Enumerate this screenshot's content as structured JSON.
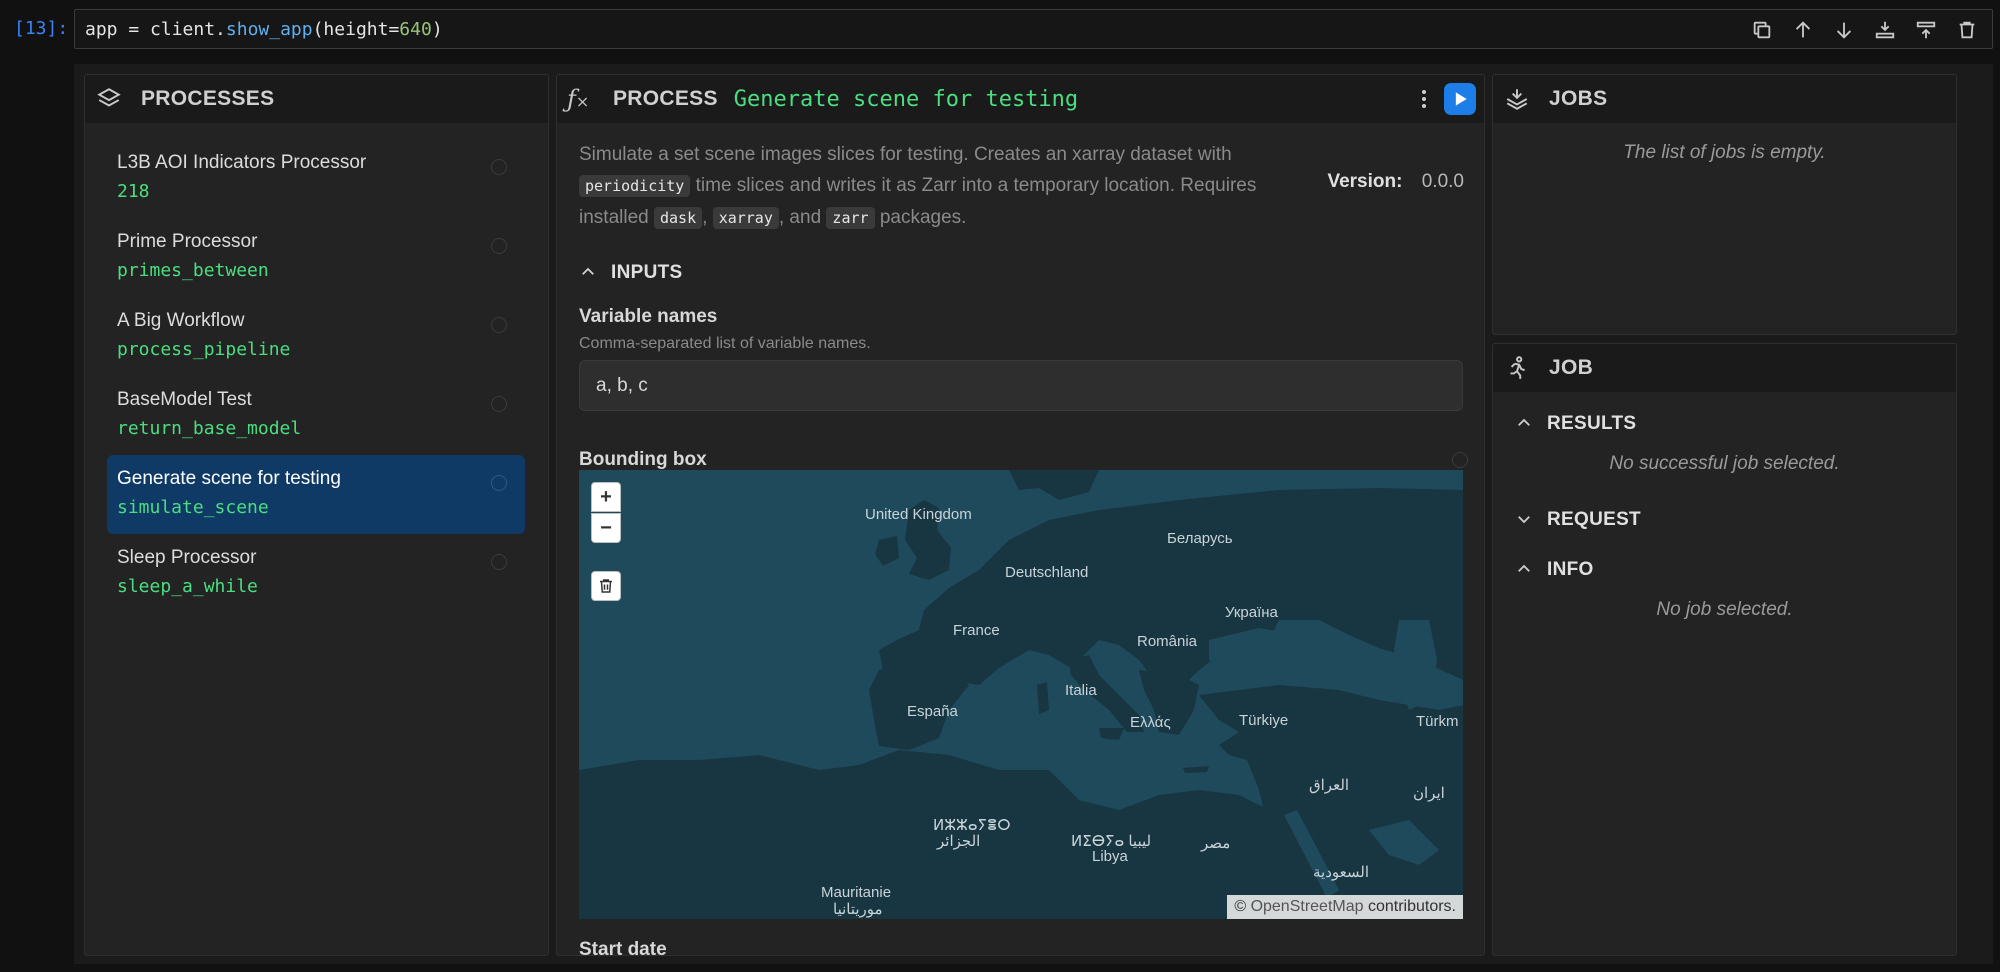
{
  "cell": {
    "exec_count": "[13]:",
    "code_prefix": "app = client.",
    "code_fn": "show_app",
    "code_mid": "(height=",
    "code_num": "640",
    "code_suffix": ")"
  },
  "toolbar": {
    "buttons": [
      "copy-icon",
      "arrow-up-icon",
      "arrow-down-icon",
      "insert-below-icon",
      "insert-above-icon",
      "trash-icon"
    ]
  },
  "processes": {
    "title": "PROCESSES",
    "items": [
      {
        "name": "L3B AOI Indicators Processor",
        "id": "218",
        "selected": false
      },
      {
        "name": "Prime Processor",
        "id": "primes_between",
        "selected": false
      },
      {
        "name": "A Big Workflow",
        "id": "process_pipeline",
        "selected": false
      },
      {
        "name": "BaseModel Test",
        "id": "return_base_model",
        "selected": false
      },
      {
        "name": "Generate scene for testing",
        "id": "simulate_scene",
        "selected": true
      },
      {
        "name": "Sleep Processor",
        "id": "sleep_a_while",
        "selected": false
      }
    ]
  },
  "process": {
    "header_label": "PROCESS",
    "title": "Generate scene for testing",
    "desc": {
      "p1": "Simulate a set scene images slices for testing. Creates an xarray dataset with",
      "chip1": "periodicity",
      "p2": " time slices and writes it as Zarr into a temporary location. Requires installed ",
      "chip2": "dask",
      "sep1": ", ",
      "chip3": "xarray",
      "sep2": ", and ",
      "chip4": "zarr",
      "p3": " packages."
    },
    "version_label": "Version:",
    "version_value": "0.0.0",
    "inputs_label": "INPUTS",
    "var_names": {
      "label": "Variable names",
      "description": "Comma-separated list of variable names.",
      "value": "a, b, c"
    },
    "bbox": {
      "label": "Bounding box",
      "zoom_in": "+",
      "zoom_out": "−",
      "attribution_prefix": "© ",
      "attribution_link": "OpenStreetMap",
      "attribution_suffix": " contributors.",
      "labels": [
        {
          "text": "United Kingdom"
        },
        {
          "text": "Беларусь"
        },
        {
          "text": "Deutschland"
        },
        {
          "text": "Україна"
        },
        {
          "text": "France"
        },
        {
          "text": "România"
        },
        {
          "text": "Italia"
        },
        {
          "text": "España"
        },
        {
          "text": "Ελλάς"
        },
        {
          "text": "Türkiye"
        },
        {
          "text": "Türkm"
        },
        {
          "text": "العراق"
        },
        {
          "text": "ایران"
        },
        {
          "text": "ⵍⵣⵣⴰⵢⴻⵔ"
        },
        {
          "text": "الجزائر"
        },
        {
          "text": "ⵍⵉⴱⵢⴰ ليبيا"
        },
        {
          "text": "Libya"
        },
        {
          "text": "مصر"
        },
        {
          "text": "السعودية"
        },
        {
          "text": "Mauritanie"
        },
        {
          "text": "موريتانيا"
        }
      ]
    },
    "next_field_label": "Start date"
  },
  "jobs": {
    "title": "JOBS",
    "empty_message": "The list of jobs is empty."
  },
  "job": {
    "title": "JOB",
    "results_label": "RESULTS",
    "results_message": "No successful job selected.",
    "request_label": "REQUEST",
    "info_label": "INFO",
    "info_message": "No job selected."
  },
  "colors": {
    "accent_green": "#4ade80",
    "selected_bg": "#0f3a66",
    "run_button": "#1c7ee6",
    "map_water": "#1e4a5c",
    "map_land": "#173642"
  }
}
